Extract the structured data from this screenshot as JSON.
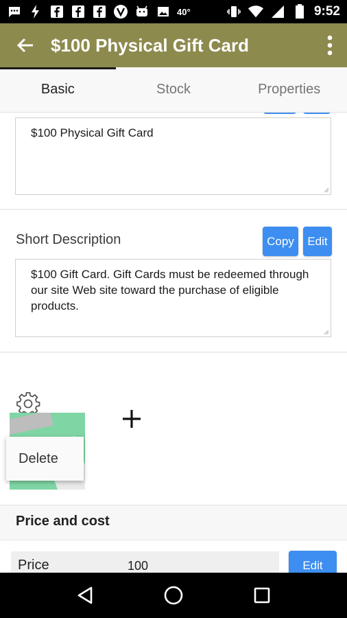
{
  "status_bar": {
    "temperature": "40°",
    "time": "9:52",
    "icons": [
      "message-icon",
      "flash-icon",
      "facebook-icon",
      "facebook-icon",
      "facebook-icon",
      "vine-icon",
      "android-icon",
      "image-icon",
      "vibrate-icon",
      "wifi-icon",
      "signal-icon",
      "battery-icon"
    ]
  },
  "app_bar": {
    "title": "$100 Physical Gift Card",
    "back_icon": "arrow-back-icon",
    "menu_icon": "more-vert-icon",
    "color": "#8d8a4e"
  },
  "tabs": [
    {
      "label": "Basic",
      "active": true
    },
    {
      "label": "Stock",
      "active": false
    },
    {
      "label": "Properties",
      "active": false
    }
  ],
  "name_field": {
    "value": "$100 Physical Gift Card"
  },
  "short_description": {
    "label": "Short Description",
    "copy_label": "Copy",
    "edit_label": "Edit",
    "value": "$100 Gift Card. Gift Cards must be redeemed through our site Web site toward the purchase of eligible products."
  },
  "images": {
    "settings_icon": "gear-icon",
    "add_icon": "plus-icon",
    "popup_menu": {
      "delete_label": "Delete"
    }
  },
  "price_and_cost": {
    "title": "Price and cost",
    "price_label": "Price",
    "price_value": "100",
    "edit_label": "Edit"
  },
  "colors": {
    "accent_blue": "#3d8ef0"
  },
  "nav_bar": {
    "icons": [
      "back-triangle-icon",
      "home-circle-icon",
      "recents-square-icon"
    ]
  }
}
